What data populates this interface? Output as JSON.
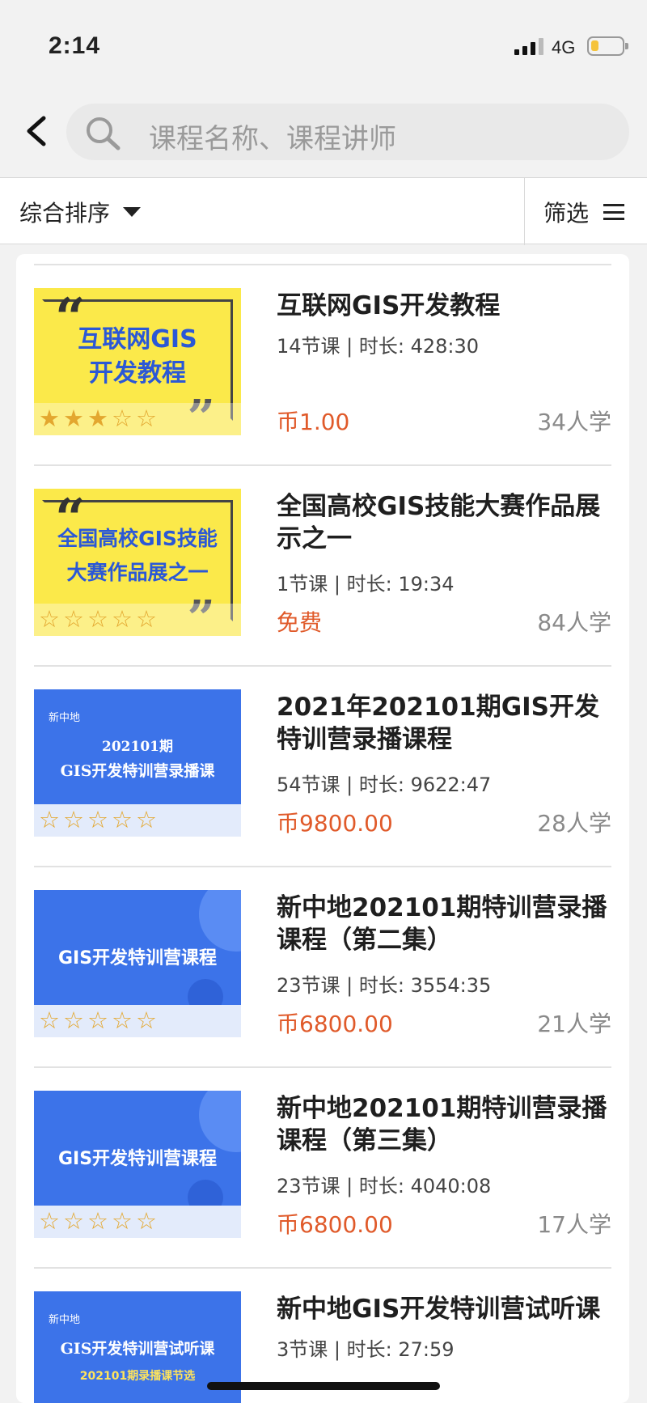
{
  "status_bar": {
    "time": "2:14",
    "network": "4G",
    "battery_level": 0.25
  },
  "search": {
    "placeholder": "课程名称、课程讲师"
  },
  "filter_bar": {
    "sort_label": "综合排序",
    "filter_label": "筛选"
  },
  "colors": {
    "price": "#e05a2a",
    "blue_thumb": "#3c73e9",
    "yellow_thumb": "#fbe94a",
    "star": "#e3a72f"
  },
  "courses": [
    {
      "title": "互联网GIS开发教程",
      "meta": "14节课 | 时长: 428:30",
      "price": "币1.00",
      "learners": "34人学",
      "rating": 3,
      "thumb": {
        "style": "yellow",
        "lines": [
          "互联网GIS",
          "开发教程"
        ]
      }
    },
    {
      "title": "全国高校GIS技能大赛作品展示之一",
      "meta": "1节课 | 时长: 19:34",
      "price": "免费",
      "learners": "84人学",
      "rating": 0,
      "thumb": {
        "style": "yellow",
        "lines": [
          "全国高校GIS技能",
          "大赛作品展之一"
        ]
      }
    },
    {
      "title": "2021年202101期GIS开发特训营录播课程",
      "meta": "54节课 | 时长: 9622:47",
      "price": "币9800.00",
      "learners": "28人学",
      "rating": 0,
      "thumb": {
        "style": "blue",
        "lines": [
          "新中地",
          "202101期",
          "GIS开发特训营录播课"
        ]
      }
    },
    {
      "title": "新中地202101期特训营录播课程（第二集）",
      "meta": "23节课 | 时长: 3554:35",
      "price": "币6800.00",
      "learners": "21人学",
      "rating": 0,
      "thumb": {
        "style": "blue",
        "lines": [
          "GIS开发特训营课程"
        ]
      }
    },
    {
      "title": "新中地202101期特训营录播课程（第三集）",
      "meta": "23节课 | 时长: 4040:08",
      "price": "币6800.00",
      "learners": "17人学",
      "rating": 0,
      "thumb": {
        "style": "blue",
        "lines": [
          "GIS开发特训营课程"
        ]
      }
    },
    {
      "title": "新中地GIS开发特训营试听课",
      "meta": "3节课 | 时长: 27:59",
      "price": "",
      "learners": "",
      "rating": 0,
      "thumb": {
        "style": "blue",
        "lines": [
          "新中地",
          "GIS开发特训营试听课",
          "202101期录播课节选"
        ]
      }
    }
  ]
}
